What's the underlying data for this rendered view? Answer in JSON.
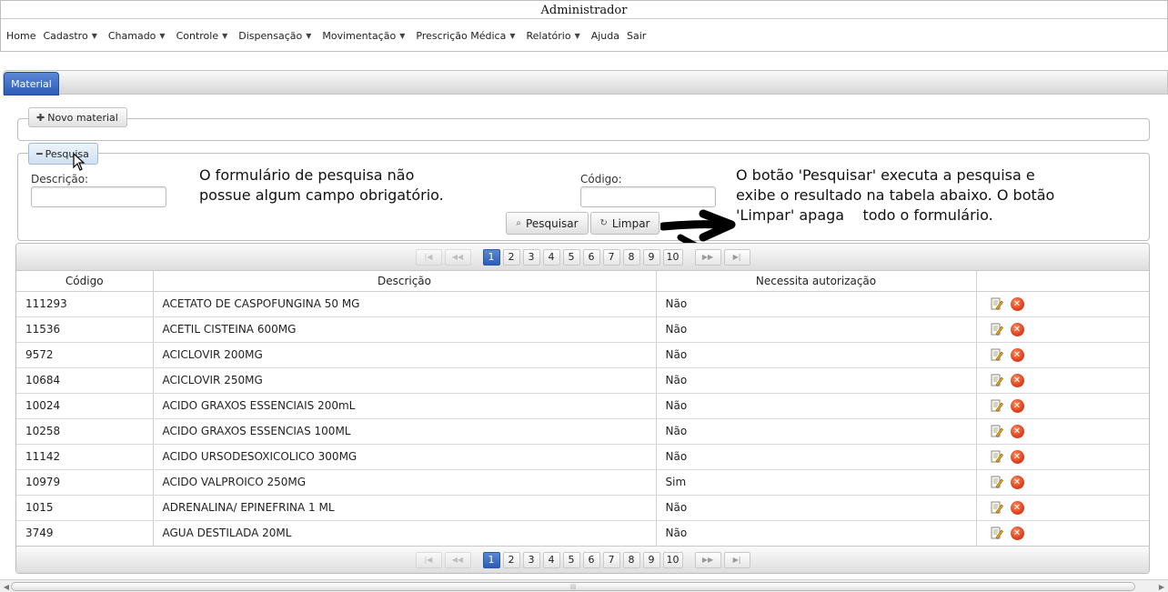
{
  "header": {
    "user": "Administrador"
  },
  "menu": {
    "items": [
      {
        "label": "Home",
        "dropdown": false
      },
      {
        "label": "Cadastro",
        "dropdown": true
      },
      {
        "label": "Chamado",
        "dropdown": true
      },
      {
        "label": "Controle",
        "dropdown": true
      },
      {
        "label": "Dispensação",
        "dropdown": true
      },
      {
        "label": "Movimentação",
        "dropdown": true
      },
      {
        "label": "Prescrição Médica",
        "dropdown": true
      },
      {
        "label": "Relatório",
        "dropdown": true
      },
      {
        "label": "Ajuda",
        "dropdown": false
      },
      {
        "label": "Sair",
        "dropdown": false
      }
    ]
  },
  "tabs": {
    "active": "Material"
  },
  "novo": {
    "label": "Novo material",
    "icon": "plus-icon"
  },
  "search": {
    "toggle_label": "Pesquisa",
    "toggle_icon": "minus-icon",
    "descricao_label": "Descrição:",
    "descricao_value": "",
    "codigo_label": "Código:",
    "codigo_value": "",
    "search_button": "Pesquisar",
    "clear_button": "Limpar"
  },
  "annotations": {
    "left": "O formulário de pesquisa não possue algum campo obrigatório.",
    "right": "O botão 'Pesquisar' executa a pesquisa e exibe o resultado na tabela abaixo. O botão 'Limpar' apaga    todo o formulário."
  },
  "pagination": {
    "pages": [
      "1",
      "2",
      "3",
      "4",
      "5",
      "6",
      "7",
      "8",
      "9",
      "10"
    ],
    "current": "1"
  },
  "table": {
    "columns": [
      "Código",
      "Descrição",
      "Necessita autorização",
      ""
    ],
    "rows": [
      {
        "codigo": "111293",
        "descricao": "ACETATO DE CASPOFUNGINA 50 MG",
        "autorizacao": "Não"
      },
      {
        "codigo": "11536",
        "descricao": "ACETIL CISTEINA 600MG",
        "autorizacao": "Não"
      },
      {
        "codigo": "9572",
        "descricao": "ACICLOVIR 200MG",
        "autorizacao": "Não"
      },
      {
        "codigo": "10684",
        "descricao": "ACICLOVIR 250MG",
        "autorizacao": "Não"
      },
      {
        "codigo": "10024",
        "descricao": "ACIDO GRAXOS ESSENCIAIS 200mL",
        "autorizacao": "Não"
      },
      {
        "codigo": "10258",
        "descricao": "ACIDO GRAXOS ESSENCIAS 100ML",
        "autorizacao": "Não"
      },
      {
        "codigo": "11142",
        "descricao": "ACIDO URSODESOXICOLICO 300MG",
        "autorizacao": "Não"
      },
      {
        "codigo": "10979",
        "descricao": "ACIDO VALPROICO 250MG",
        "autorizacao": "Sim"
      },
      {
        "codigo": "1015",
        "descricao": "ADRENALINA/ EPINEFRINA 1 ML",
        "autorizacao": "Não"
      },
      {
        "codigo": "3749",
        "descricao": "AGUA DESTILADA 20ML",
        "autorizacao": "Não"
      }
    ]
  },
  "colors": {
    "accent": "#2c5cb6",
    "delete": "#e0411b"
  }
}
